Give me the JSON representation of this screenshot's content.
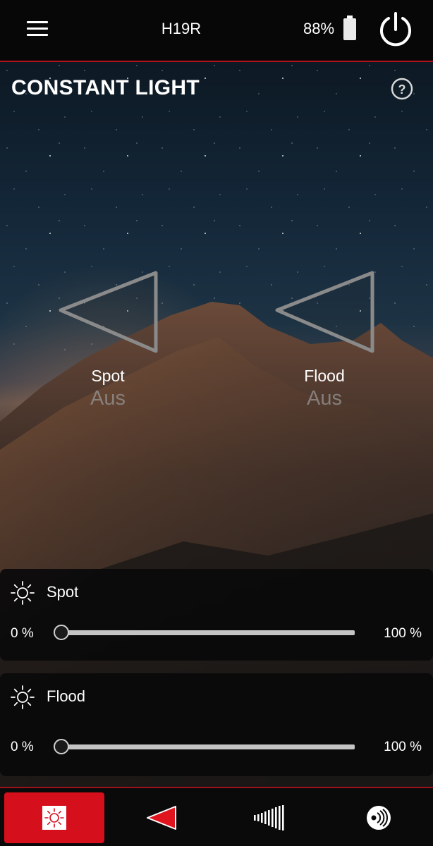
{
  "header": {
    "device_name": "H19R",
    "battery_percent": "88%",
    "battery_level": 0.88,
    "menu_icon": "hamburger-menu-icon",
    "power_icon": "power-icon"
  },
  "page": {
    "title": "CONSTANT LIGHT",
    "help_icon": "help-icon"
  },
  "modes": [
    {
      "label": "Spot",
      "status": "Aus",
      "icon": "spot-beam-icon"
    },
    {
      "label": "Flood",
      "status": "Aus",
      "icon": "flood-beam-icon"
    }
  ],
  "sliders": [
    {
      "label": "Spot",
      "min_label": "0 %",
      "max_label": "100 %",
      "value_percent": 0,
      "icon": "brightness-icon"
    },
    {
      "label": "Flood",
      "min_label": "0 %",
      "max_label": "100 %",
      "value_percent": 0,
      "icon": "brightness-icon"
    }
  ],
  "bottom_nav": {
    "active_index": 0,
    "items": [
      {
        "icon": "constant-light-icon"
      },
      {
        "icon": "beam-icon"
      },
      {
        "icon": "signal-bars-icon"
      },
      {
        "icon": "sensor-icon"
      }
    ]
  },
  "colors": {
    "accent": "#d50f1c",
    "divider": "#b3111b",
    "inactive_text": "#8a8a8a"
  }
}
